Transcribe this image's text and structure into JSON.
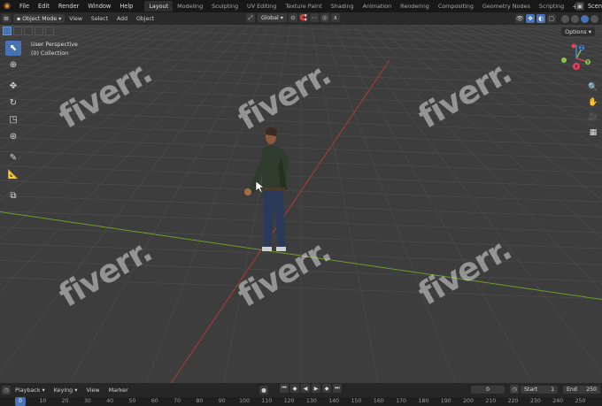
{
  "menu": {
    "items": [
      "File",
      "Edit",
      "Render",
      "Window",
      "Help"
    ]
  },
  "workspace_tabs": [
    "Layout",
    "Modeling",
    "Sculpting",
    "UV Editing",
    "Texture Paint",
    "Shading",
    "Animation",
    "Rendering",
    "Compositing",
    "Geometry Nodes",
    "Scripting"
  ],
  "active_tab": "Layout",
  "scene_label": "Scen",
  "header": {
    "mode": "Object Mode",
    "view": "View",
    "select": "Select",
    "add": "Add",
    "object": "Object",
    "orientation": "Global",
    "options": "Options"
  },
  "viewport": {
    "perspective_label": "User Perspective",
    "collection_label": "(0) Collection",
    "watermark": "fiverr."
  },
  "gizmo": {
    "x": "X",
    "y": "Y",
    "z": "Z",
    "x_color": "#e8425a",
    "y_color": "#8bc24a",
    "z_color": "#3d8ae0"
  },
  "timeline": {
    "playback": "Playback",
    "keying": "Keying",
    "view": "View",
    "marker": "Marker",
    "current_frame": "0",
    "start_label": "Start",
    "start_value": "1",
    "end_label": "End",
    "end_value": "250",
    "ruler": [
      "0",
      "10",
      "20",
      "30",
      "40",
      "50",
      "60",
      "70",
      "80",
      "90",
      "100",
      "110",
      "120",
      "130",
      "140",
      "150",
      "160",
      "170",
      "180",
      "190",
      "200",
      "210",
      "220",
      "230",
      "240",
      "250"
    ]
  },
  "colors": {
    "accent": "#4772b3",
    "x_axis": "#b33a3a",
    "y_axis": "#6f9b2b",
    "grid": "#4a4a4a",
    "viewport_bg": "#3d3d3d"
  }
}
